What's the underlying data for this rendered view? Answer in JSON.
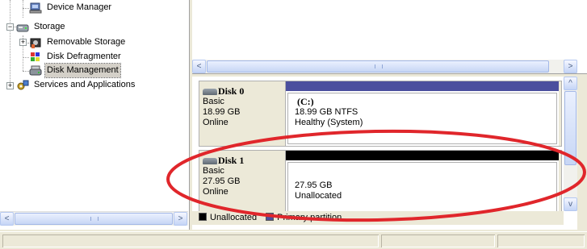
{
  "tree": {
    "items": [
      {
        "label": "Device Manager",
        "icon": "device-manager-icon"
      },
      {
        "label": "Storage",
        "icon": "storage-icon",
        "expander": "−"
      },
      {
        "label": "Removable Storage",
        "icon": "removable-storage-icon",
        "expander": "+"
      },
      {
        "label": "Disk Defragmenter",
        "icon": "disk-defragmenter-icon"
      },
      {
        "label": "Disk Management",
        "icon": "disk-management-icon",
        "selected": true
      },
      {
        "label": "Services and Applications",
        "icon": "services-icon",
        "expander": "+"
      }
    ]
  },
  "scrollbars": {
    "left_h": {
      "left_arrow": "<",
      "right_arrow": ">"
    },
    "top_h": {
      "left_arrow": "<",
      "right_arrow": ">"
    },
    "right_v": {
      "up_arrow": "^",
      "down_arrow": "v"
    }
  },
  "disks": [
    {
      "name": "Disk 0",
      "type": "Basic",
      "size": "18.99 GB",
      "status": "Online",
      "partition": {
        "bar_color": "#4b4f9e",
        "label": "(C:)",
        "detail": "18.99 GB NTFS",
        "state": "Healthy (System)"
      }
    },
    {
      "name": "Disk 1",
      "type": "Basic",
      "size": "27.95 GB",
      "status": "Online",
      "partition": {
        "bar_color": "#000000",
        "label": "",
        "detail": "27.95 GB",
        "state": "Unallocated"
      }
    }
  ],
  "legend": {
    "unallocated_label": "Unallocated",
    "unallocated_color": "#000000",
    "primary_label": "Primary partition",
    "primary_color": "#4b4f9e"
  },
  "annotation": {
    "color": "#e0262b"
  }
}
